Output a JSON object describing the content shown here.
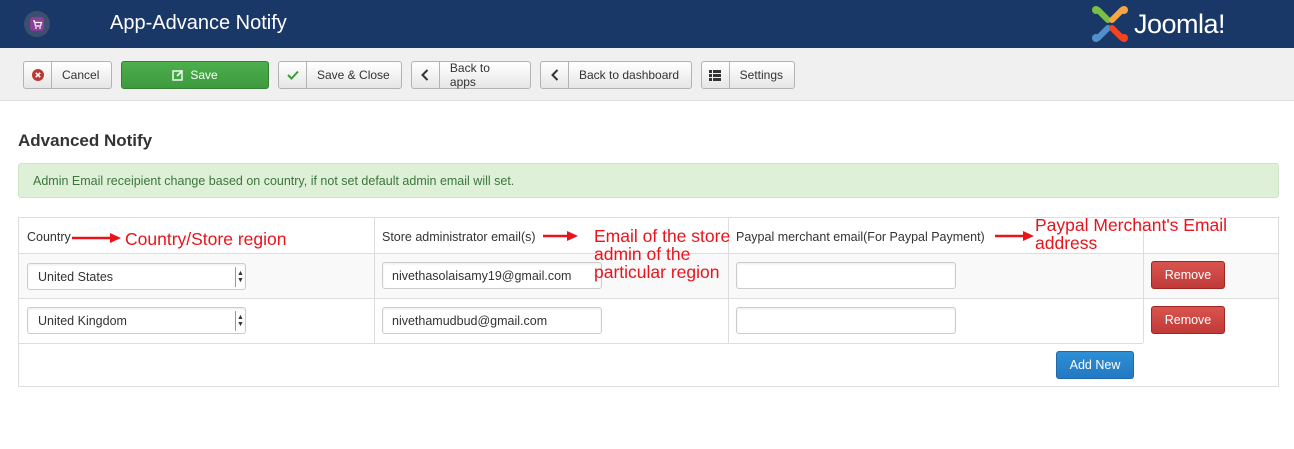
{
  "header": {
    "title": "App-Advance Notify",
    "brand": "Joomla!",
    "bg_color": "#1a3867"
  },
  "toolbar": {
    "cancel_label": "Cancel",
    "save_label": "Save",
    "save_close_label": "Save & Close",
    "back_apps_label": "Back to apps",
    "back_dashboard_label": "Back to dashboard",
    "settings_label": "Settings"
  },
  "page": {
    "title": "Advanced Notify",
    "alert": "Admin Email receipient change based on country, if not set default admin email will set."
  },
  "table": {
    "headers": [
      "Country",
      "Store administrator email(s)",
      "Paypal merchant email(For Paypal Payment)"
    ],
    "rows": [
      {
        "country": "United States",
        "store_email": "nivethasolaisamy19@gmail.com",
        "paypal_email": "",
        "remove_label": "Remove"
      },
      {
        "country": "United Kingdom",
        "store_email": "nivethamudbud@gmail.com",
        "paypal_email": "",
        "remove_label": "Remove"
      }
    ],
    "add_new_label": "Add New"
  },
  "annotations": {
    "country": "Country/Store region",
    "store_email_line1": "Email of the store",
    "store_email_line2": "admin of the",
    "store_email_line3": "particular region",
    "paypal_line1": "Paypal Merchant's Email",
    "paypal_line2": "address",
    "color": "#e8141c"
  }
}
